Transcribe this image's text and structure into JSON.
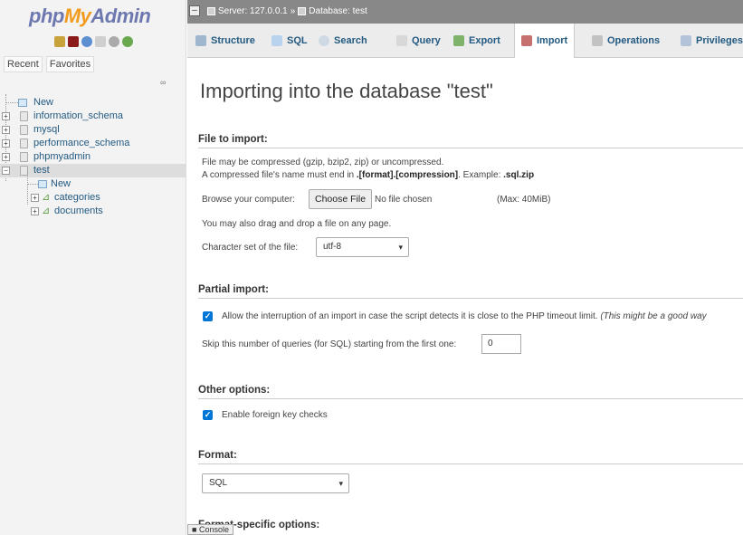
{
  "sidebar": {
    "logo": {
      "php": "php",
      "my": "My",
      "admin": "Admin"
    },
    "recent_tab": "Recent",
    "favorites_tab": "Favorites",
    "link_icon": "link-icon",
    "tree": [
      {
        "label": "New"
      },
      {
        "label": "information_schema"
      },
      {
        "label": "mysql"
      },
      {
        "label": "performance_schema"
      },
      {
        "label": "phpmyadmin"
      },
      {
        "label": "test"
      },
      {
        "label": "New"
      },
      {
        "label": "categories"
      },
      {
        "label": "documents"
      }
    ]
  },
  "topbar": {
    "server": "Server: 127.0.0.1",
    "separator": "»",
    "database": "Database: test"
  },
  "menu": {
    "tabs": [
      {
        "label": "Structure"
      },
      {
        "label": "SQL"
      },
      {
        "label": "Search"
      },
      {
        "label": "Query"
      },
      {
        "label": "Export"
      },
      {
        "label": "Import"
      },
      {
        "label": "Operations"
      },
      {
        "label": "Privileges"
      }
    ]
  },
  "main": {
    "title": "Importing into the database \"test\"",
    "file_section": {
      "heading": "File to import:",
      "compressed_note": "File may be compressed (gzip, bzip2, zip) or uncompressed.",
      "name_note_prefix": "A compressed file's name must end in ",
      "name_note_format": ".[format].[compression]",
      "name_note_example_label": ". Example: ",
      "name_note_example": ".sql.zip",
      "browse_label": "Browse your computer:",
      "choose_file": "Choose File",
      "no_file": "No file chosen",
      "max": "(Max: 40MiB)",
      "drag_note": "You may also drag and drop a file on any page.",
      "charset_label": "Character set of the file:",
      "charset_value": "utf-8"
    },
    "partial_section": {
      "heading": "Partial import:",
      "allow_interrupt": "Allow the interruption of an import in case the script detects it is close to the PHP timeout limit.",
      "allow_interrupt_note": "(This might be a good way",
      "skip_label": "Skip this number of queries (for SQL) starting from the first one:",
      "skip_value": "0"
    },
    "other_section": {
      "heading": "Other options:",
      "fk_checks": "Enable foreign key checks"
    },
    "format_section": {
      "heading": "Format:",
      "format_value": "SQL"
    },
    "format_specific_heading": "Format-specific options:"
  },
  "console": {
    "label": "Console"
  }
}
